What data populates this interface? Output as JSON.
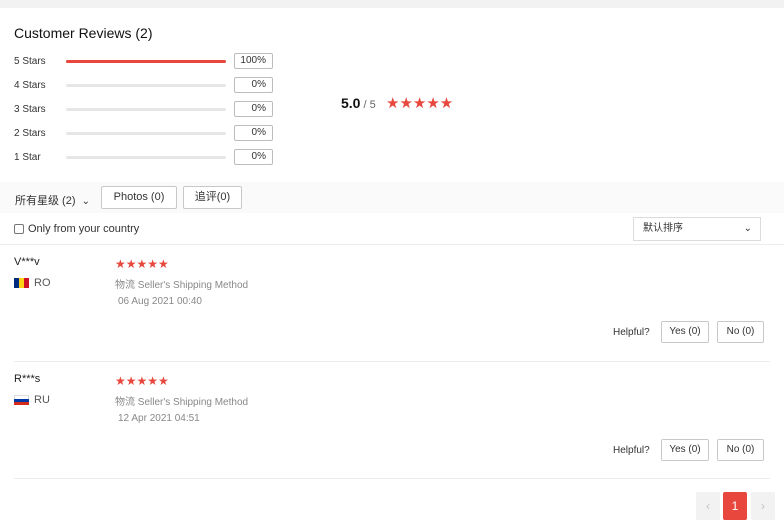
{
  "summary": {
    "title": "Customer Reviews (2)",
    "distribution": [
      {
        "label": "5 Stars",
        "percent": "100%",
        "fill": 1.0
      },
      {
        "label": "4 Stars",
        "percent": "0%",
        "fill": 0
      },
      {
        "label": "3 Stars",
        "percent": "0%",
        "fill": 0
      },
      {
        "label": "2 Stars",
        "percent": "0%",
        "fill": 0
      },
      {
        "label": "1 Star",
        "percent": "0%",
        "fill": 0
      }
    ],
    "average": "5.0",
    "out_of": "/ 5",
    "average_stars": "★★★★★"
  },
  "filters": {
    "all_ratings": "所有星级 (2)",
    "all_ratings_caret": "⌄",
    "photos": "Photos (0)",
    "followup": "追评(0)",
    "country_only": "Only from your country",
    "sort_value": "默认排序",
    "sort_caret": "⌄"
  },
  "reviews": [
    {
      "name": "V***v",
      "country": "RO",
      "flag": [
        "#002b7f",
        "#fcd116",
        "#ce1126"
      ],
      "stars": "★★★★★",
      "shipping": "物流 Seller's Shipping Method",
      "date": "06 Aug 2021 00:40",
      "helpful_label": "Helpful?",
      "yes": "Yes (0)",
      "no": "No (0)"
    },
    {
      "name": "R***s",
      "country": "RU",
      "flag": [
        "#ffffff",
        "#0039a6",
        "#d52b1e"
      ],
      "stars": "★★★★★",
      "shipping": "物流 Seller's Shipping Method",
      "date": "12 Apr 2021 04:51",
      "helpful_label": "Helpful?",
      "yes": "Yes (0)",
      "no": "No (0)"
    }
  ],
  "pagination": {
    "prev": "‹",
    "current": "1",
    "next": "›"
  },
  "colors": {
    "accent": "#e8473d"
  }
}
